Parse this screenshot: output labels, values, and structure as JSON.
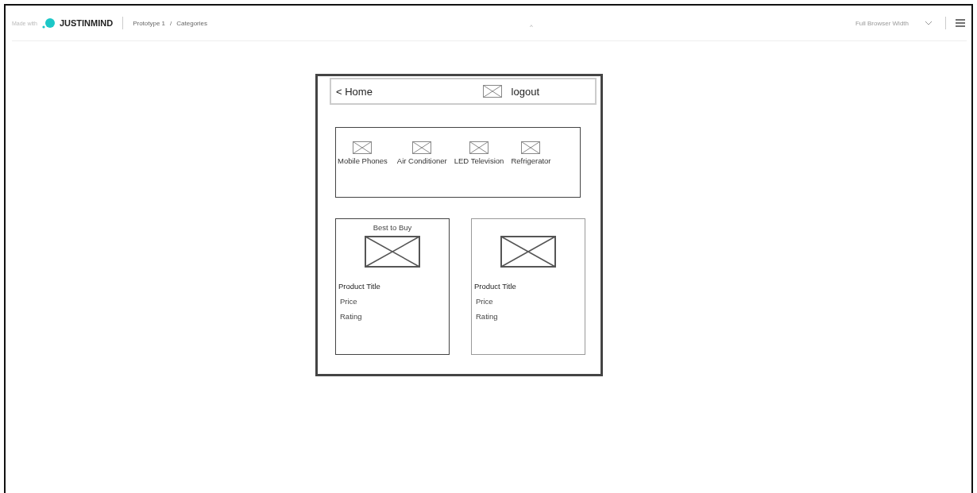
{
  "topbar": {
    "made_with": "Made with",
    "brand": "JUSTINMIND",
    "breadcrumb": [
      "Prototype 1",
      "Categories"
    ],
    "separator": "/",
    "view_mode": "Full Browser Width",
    "collapse": "^"
  },
  "header": {
    "back": "< Home",
    "logout": "logout"
  },
  "categories": [
    {
      "label": "Mobile Phones"
    },
    {
      "label": "Air Conditioner"
    },
    {
      "label": "LED Television"
    },
    {
      "label": "Refrigerator"
    }
  ],
  "products": [
    {
      "badge": "Best to Buy",
      "title": "Product Title",
      "price": "Price",
      "rating": "Rating"
    },
    {
      "title": "Product Title",
      "price": "Price",
      "rating": "Rating"
    }
  ]
}
